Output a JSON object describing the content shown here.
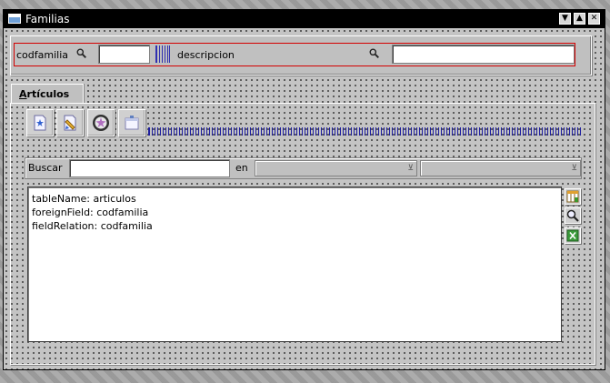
{
  "window": {
    "title": "Familias",
    "icon": "window-icon",
    "controls": [
      "minimize",
      "maximize",
      "close"
    ]
  },
  "filter": {
    "field1_label": "codfamilia",
    "field1_value": "",
    "field2_label": "descripcion",
    "field2_value": "",
    "search_icon": "magnifier-icon",
    "border_color": "#d40000"
  },
  "tabs": [
    {
      "label": "Artículos",
      "active": true
    }
  ],
  "toolbar": {
    "buttons": [
      "new-record-icon",
      "edit-record-icon",
      "delete-record-icon",
      "view-record-icon"
    ]
  },
  "search": {
    "label": "Buscar",
    "value": "",
    "in_label": "en",
    "combo1_value": "",
    "combo2_value": ""
  },
  "results": {
    "lines": [
      "tableName: articulos",
      "foreignField: codfamilia",
      "fieldRelation: codfamilia"
    ]
  },
  "side_buttons": [
    "table-config-icon",
    "zoom-icon",
    "excel-export-icon"
  ]
}
